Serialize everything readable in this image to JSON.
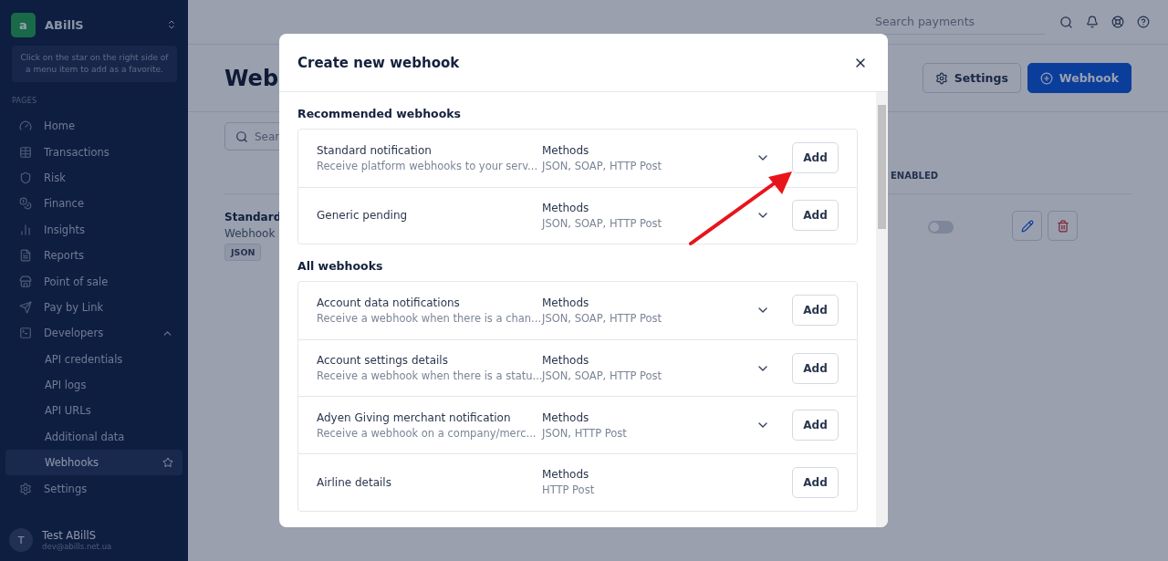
{
  "sidebar": {
    "brand": "ABillS",
    "brand_mark": "a",
    "hint": "Click on the star on the right side of a menu item to add as a favorite.",
    "section_label": "PAGES",
    "items": [
      {
        "label": "Home",
        "selected": false
      },
      {
        "label": "Transactions",
        "selected": false
      },
      {
        "label": "Risk",
        "selected": false
      },
      {
        "label": "Finance",
        "selected": false
      },
      {
        "label": "Insights",
        "selected": false
      },
      {
        "label": "Reports",
        "selected": false
      },
      {
        "label": "Point of sale",
        "selected": false
      },
      {
        "label": "Pay by Link",
        "selected": false
      },
      {
        "label": "Developers",
        "selected": false,
        "expanded": true,
        "children": [
          {
            "label": "API credentials",
            "selected": false
          },
          {
            "label": "API logs",
            "selected": false
          },
          {
            "label": "API URLs",
            "selected": false
          },
          {
            "label": "Additional data",
            "selected": false
          },
          {
            "label": "Webhooks",
            "selected": true
          }
        ]
      },
      {
        "label": "Settings",
        "selected": false
      }
    ],
    "user": {
      "initial": "T",
      "name": "Test ABillS",
      "email": "dev@abills.net.ua"
    }
  },
  "header": {
    "search_placeholder": "Search payments"
  },
  "page": {
    "title": "Web",
    "settings_button": "Settings",
    "add_button": "Webhook",
    "search_placeholder": "Sear",
    "column_enabled": "ENABLED",
    "row": {
      "name": "Standard",
      "type": "Webhook",
      "tag": "JSON",
      "enabled": false
    }
  },
  "modal": {
    "title": "Create new webhook",
    "sections": [
      {
        "title": "Recommended webhooks",
        "items": [
          {
            "name": "Standard notification",
            "description": "Receive platform webhooks to your serv...",
            "methods_label": "Methods",
            "methods": "JSON, SOAP, HTTP Post",
            "expandable": true,
            "action": "Add"
          },
          {
            "name": "Generic pending",
            "methods_label": "Methods",
            "methods": "JSON, SOAP, HTTP Post",
            "expandable": true,
            "action": "Add"
          }
        ]
      },
      {
        "title": "All webhooks",
        "items": [
          {
            "name": "Account data notifications",
            "description": "Receive a webhook when there is a chan...",
            "methods_label": "Methods",
            "methods": "JSON, SOAP, HTTP Post",
            "expandable": true,
            "action": "Add"
          },
          {
            "name": "Account settings details",
            "description": "Receive a webhook when there is a statu...",
            "methods_label": "Methods",
            "methods": "JSON, SOAP, HTTP Post",
            "expandable": true,
            "action": "Add"
          },
          {
            "name": "Adyen Giving merchant notification",
            "description": "Receive a webhook on a company/merc...",
            "methods_label": "Methods",
            "methods": "JSON, HTTP Post",
            "expandable": true,
            "action": "Add"
          },
          {
            "name": "Airline details",
            "methods_label": "Methods",
            "methods": "HTTP Post",
            "expandable": false,
            "action": "Add"
          }
        ]
      }
    ]
  }
}
